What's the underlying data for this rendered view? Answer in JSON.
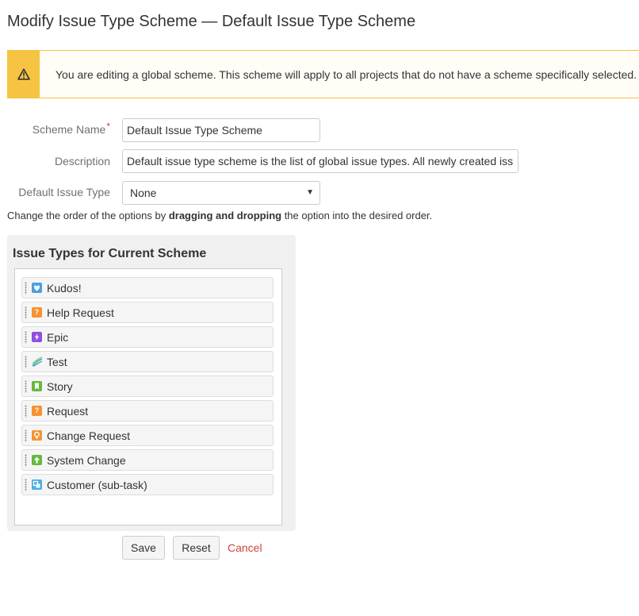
{
  "page": {
    "title": "Modify Issue Type Scheme — Default Issue Type Scheme"
  },
  "warning": {
    "icon": "warning-icon",
    "message": "You are editing a global scheme. This scheme will apply to all projects that do not have a scheme specifically selected."
  },
  "form": {
    "scheme_name_label": "Scheme Name",
    "required_marker": "*",
    "scheme_name_value": "Default Issue Type Scheme",
    "description_label": "Description",
    "description_value": "Default issue type scheme is the list of global issue types. All newly created iss",
    "default_type_label": "Default Issue Type",
    "default_type_value": "None",
    "hint_prefix": "Change the order of the options by ",
    "hint_bold": "dragging and dropping",
    "hint_suffix": " the option into the desired order."
  },
  "issue_types_panel": {
    "title": "Issue Types for Current Scheme",
    "items": [
      {
        "label": "Kudos!",
        "icon": "heart-icon",
        "color": "#4a9fe0"
      },
      {
        "label": "Help Request",
        "icon": "question-icon",
        "color": "#f79232"
      },
      {
        "label": "Epic",
        "icon": "lightning-icon",
        "color": "#904ee2"
      },
      {
        "label": "Test",
        "icon": "test-icon",
        "color": "#5fb8a6"
      },
      {
        "label": "Story",
        "icon": "bookmark-icon",
        "color": "#63ba3c"
      },
      {
        "label": "Request",
        "icon": "question-icon",
        "color": "#f79232"
      },
      {
        "label": "Change Request",
        "icon": "lightbulb-icon",
        "color": "#f79232"
      },
      {
        "label": "System Change",
        "icon": "arrow-up-icon",
        "color": "#63ba3c"
      },
      {
        "label": "Customer (sub-task)",
        "icon": "subtask-icon",
        "color": "#4bade8"
      }
    ]
  },
  "actions": {
    "save_label": "Save",
    "reset_label": "Reset",
    "cancel_label": "Cancel"
  }
}
